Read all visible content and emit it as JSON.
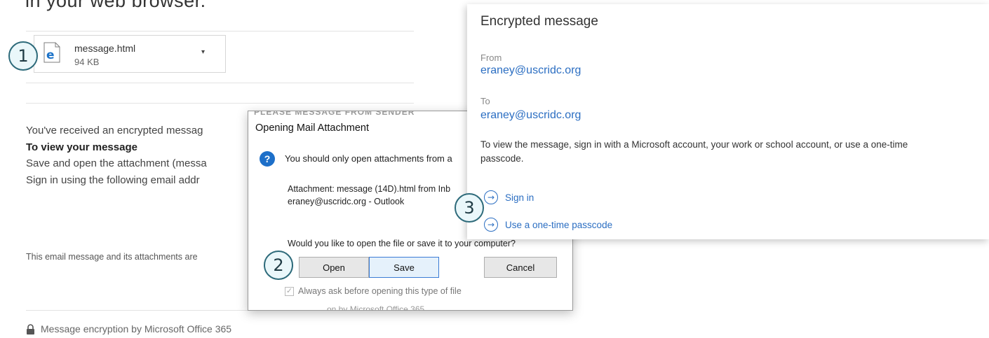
{
  "caption": "in your web browser.",
  "attachment": {
    "file_name": "message.html",
    "file_size": "94 KB",
    "dropdown_glyph": "▾",
    "icon": "ie-file-icon"
  },
  "badges": {
    "one": "1",
    "two": "2",
    "three": "3"
  },
  "email": {
    "line1": "You've received an encrypted messag",
    "heading": "To view your message",
    "line2": "Save and open the attachment (messa",
    "line3": "Sign in using the following email addr",
    "disclaimer": "This email message and its attachments are",
    "footer": "Message encryption by Microsoft Office 365"
  },
  "dialog": {
    "ghost_top": "PLEASE MESSAGE FROM SENDER",
    "title": "Opening Mail Attachment",
    "warning": "You should only open attachments from a",
    "attachment_line1": "Attachment: message (14D).html from Inb",
    "attachment_line2": "eraney@uscridc.org - Outlook",
    "question": "Would you like to open the file or save it to your computer?",
    "open_label": "Open",
    "save_label": "Save",
    "cancel_label": "Cancel",
    "checkbox_label": "Always ask before opening this type of file",
    "ghost_bottom": "on by Microsoft Office 365"
  },
  "encrypted": {
    "title": "Encrypted message",
    "from_label": "From",
    "from_address": "eraney@uscridc.org",
    "to_label": "To",
    "to_address": "eraney@uscridc.org",
    "info_line1": "To view the message, sign in with a Microsoft account, your work or school account, or use a one-time",
    "info_line2": "passcode.",
    "sign_in_label": "Sign in",
    "passcode_label": "Use a one-time passcode"
  },
  "colors": {
    "link": "#2b6ec2",
    "badge_border": "#2d6a7a",
    "dialog_accent": "#1d6fc9"
  }
}
